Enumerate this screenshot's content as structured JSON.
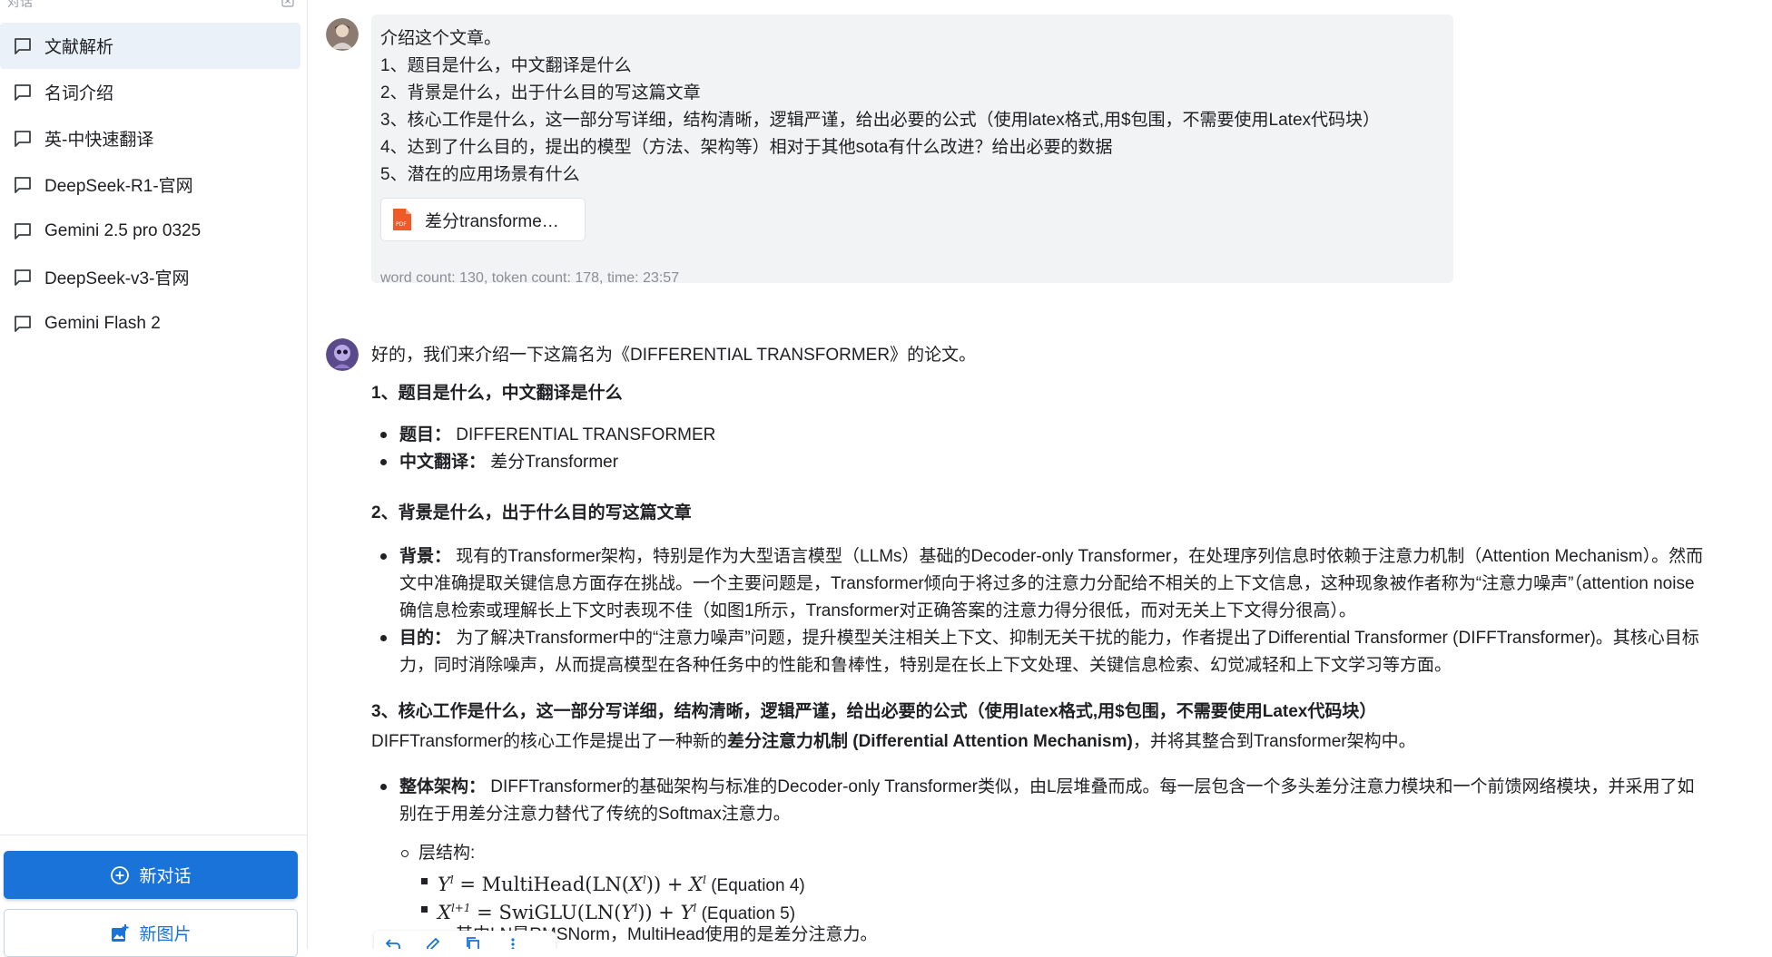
{
  "sidebar": {
    "title": "对话",
    "items": [
      {
        "label": "文献解析",
        "active": true
      },
      {
        "label": "名词介绍"
      },
      {
        "label": "英-中快速翻译"
      },
      {
        "label": "DeepSeek-R1-官网"
      },
      {
        "label": "Gemini 2.5 pro 0325"
      },
      {
        "label": "DeepSeek-v3-官网"
      },
      {
        "label": "Gemini Flash 2"
      }
    ],
    "new_chat_label": "新对话",
    "new_image_label": "新图片"
  },
  "user_message": {
    "lines": [
      "介绍这个文章。",
      "1、题目是什么，中文翻译是什么",
      "2、背景是什么，出于什么目的写这篇文章",
      "3、核心工作是什么，这一部分写详细，结构清晰，逻辑严谨，给出必要的公式（使用latex格式,用$包围，不需要使用Latex代码块）",
      "4、达到了什么目的，提出的模型（方法、架构等）相对于其他sota有什么改进？给出必要的数据",
      "5、潜在的应用场景有什么"
    ],
    "attachment_name": "差分transforme…",
    "attachment_type": "PDF",
    "meta": "word count: 130, token count: 178, time: 23:57"
  },
  "assistant_message": {
    "intro": "好的，我们来介绍一下这篇名为《DIFFERENTIAL TRANSFORMER》的论文。",
    "section1_heading": "1、题目是什么，中文翻译是什么",
    "title_label": "题目：",
    "title_value": "DIFFERENTIAL TRANSFORMER",
    "translation_label": "中文翻译：",
    "translation_value": "差分Transformer",
    "section2_heading": "2、背景是什么，出于什么目的写这篇文章",
    "background_label": "背景：",
    "background_line1": "现有的Transformer架构，特别是作为大型语言模型（LLMs）基础的Decoder-only Transformer，在处理序列信息时依赖于注意力机制（Attention Mechanism）。然而",
    "background_line2": "文中准确提取关键信息方面存在挑战。一个主要问题是，Transformer倾向于将过多的注意力分配给不相关的上下文信息，这种现象被作者称为“注意力噪声”（attention noise",
    "background_line3": "确信息检索或理解长上下文时表现不佳（如图1所示，Transformer对正确答案的注意力得分很低，而对无关上下文得分很高）。",
    "purpose_label": "目的：",
    "purpose_line1": "为了解决Transformer中的“注意力噪声”问题，提升模型关注相关上下文、抑制无关干扰的能力，作者提出了Differential Transformer (DIFFTransformer)。其核心目标",
    "purpose_line2": "力，同时消除噪声，从而提高模型在各种任务中的性能和鲁棒性，特别是在长上下文处理、关键信息检索、幻觉减轻和上下文学习等方面。",
    "section3_heading": "3、核心工作是什么，这一部分写详细，结构清晰，逻辑严谨，给出必要的公式（使用latex格式,用$包围，不需要使用Latex代码块）",
    "core_prefix": "DIFFTransformer的核心工作是提出了一种新的",
    "core_bold": "差分注意力机制 (Differential Attention Mechanism)",
    "core_suffix": "，并将其整合到Transformer架构中。",
    "arch_label": "整体架构：",
    "arch_line1": "DIFFTransformer的基础架构与标准的Decoder-only Transformer类似，由L层堆叠而成。每一层包含一个多头差分注意力模块和一个前馈网络模块，并采用了如",
    "arch_line2": "别在于用差分注意力替代了传统的Softmax注意力。",
    "layer_label": "层结构:",
    "eq4_label": "(Equation 4)",
    "eq5_label": "(Equation 5)",
    "eq_note": "其中LN是RMSNorm，MultiHead使用的是差分注意力。"
  }
}
